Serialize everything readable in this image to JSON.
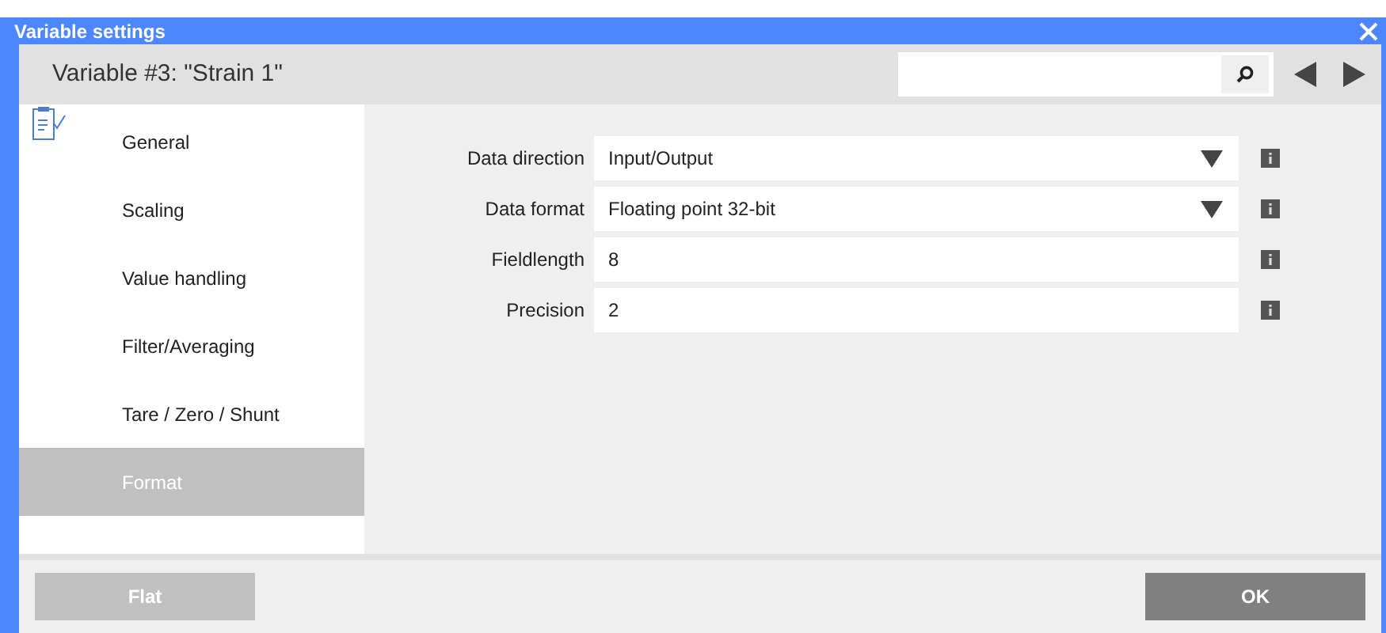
{
  "window": {
    "title": "Variable settings"
  },
  "header": {
    "title": "Variable #3: \"Strain 1\""
  },
  "sidebar": {
    "items": [
      {
        "label": "General",
        "selected": false
      },
      {
        "label": "Scaling",
        "selected": false
      },
      {
        "label": "Value handling",
        "selected": false
      },
      {
        "label": "Filter/Averaging",
        "selected": false
      },
      {
        "label": "Tare / Zero / Shunt",
        "selected": false
      },
      {
        "label": "Format",
        "selected": true
      }
    ]
  },
  "fields": [
    {
      "label": "Data direction",
      "kind": "dropdown",
      "value": "Input/Output"
    },
    {
      "label": "Data format",
      "kind": "dropdown",
      "value": "Floating point 32-bit"
    },
    {
      "label": "Fieldlength",
      "kind": "text",
      "value": "8"
    },
    {
      "label": "Precision",
      "kind": "text",
      "value": "2"
    }
  ],
  "buttons": [
    {
      "label": "Flat",
      "disabled": true
    },
    {
      "label": "OK",
      "disabled": false
    }
  ]
}
